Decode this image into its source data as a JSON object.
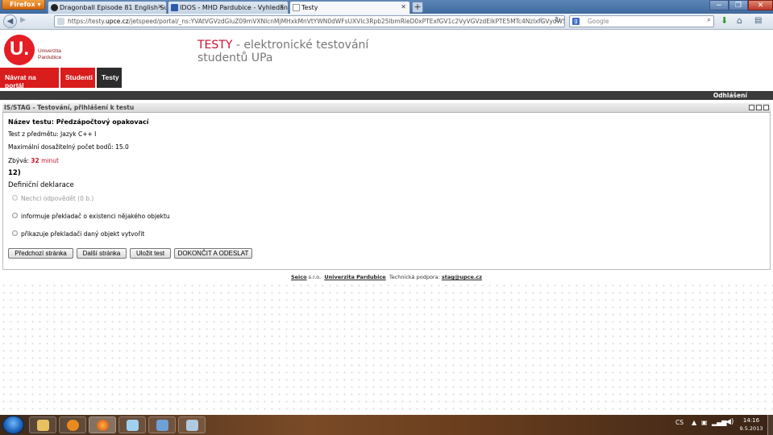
{
  "browser": {
    "menu_button": "Firefox",
    "tabs": [
      {
        "label": "Dragonball Episode 81 English Sub",
        "active": false
      },
      {
        "label": "IDOS - MHD Pardubice - Vyhledání s...",
        "active": false
      },
      {
        "label": "Testy",
        "active": true
      }
    ],
    "new_tab": "+",
    "window_controls": [
      "−",
      "❐",
      "✕"
    ],
    "url_prefix": "https://testy.",
    "url_host": "upce.cz",
    "url_rest": "/jetspeed/portal/_ns:YVAtVGVzdGluZ09mVXNlcnMjMHxkMnVtYWN0dWFsUXVlc3Rpb25lbmRleD0xPTExfGV1c2VyVGVzdElkPTE5MTc4NzIxfGVydW5uaW5nVGVzdD0xP...",
    "search_engine": "Google",
    "search_placeholder": "Google",
    "icons": [
      "back-icon",
      "forward-icon",
      "star-icon",
      "reload-icon",
      "download-icon",
      "home-icon",
      "menu-icon"
    ]
  },
  "header": {
    "logo_letter": "U.",
    "logo_line1": "Univerzita",
    "logo_line2": "Pardubice",
    "title_red": "TESTY",
    "title_rest": " - elektronické testování",
    "title_line2": "studentů UPa"
  },
  "menu": {
    "items": [
      {
        "label": "Návrat na portál",
        "style": "red"
      },
      {
        "label": "Studenti",
        "style": "red"
      },
      {
        "label": "Testy",
        "style": "dark"
      }
    ],
    "logout": "Odhlášení"
  },
  "panel": {
    "title": "IS/STAG - Testování, přihlášení k testu",
    "test_name_label": "Název testu: Předzápočtový opakovací",
    "subject": "Test z předmětu: Jazyk C++ I",
    "max_points": "Maximální dosažitelný počet bodů: 15.0",
    "remaining_label": "Zbývá:",
    "remaining_value": "32",
    "remaining_unit": "minut",
    "question_number": "12)",
    "question_text": "Definiční deklarace",
    "options": [
      "Nechci odpovědět (0 b.)",
      "informuje překladač o existenci nějakého objektu",
      "přikazuje překladači daný objekt vytvořit"
    ],
    "buttons": {
      "prev": "Předchozí stránka",
      "next": "Další stránka",
      "save": "Uložit test",
      "finish": "DOKONČIT A ODESLAT"
    }
  },
  "footer": {
    "company": "Seico",
    "company_suffix": " s.r.o.",
    "university": "Univerzita Pardubice",
    "support_label": "Technická podpora:",
    "support_email": "stag@upce.cz"
  },
  "taskbar": {
    "lang": "CS",
    "time": "14:16",
    "date": "9.5.2013"
  },
  "colors": {
    "brand_red": "#d91c1c",
    "logo_red": "#e31e24",
    "dark_bar": "#3b3b3b",
    "remaining_red": "#c8102e"
  }
}
